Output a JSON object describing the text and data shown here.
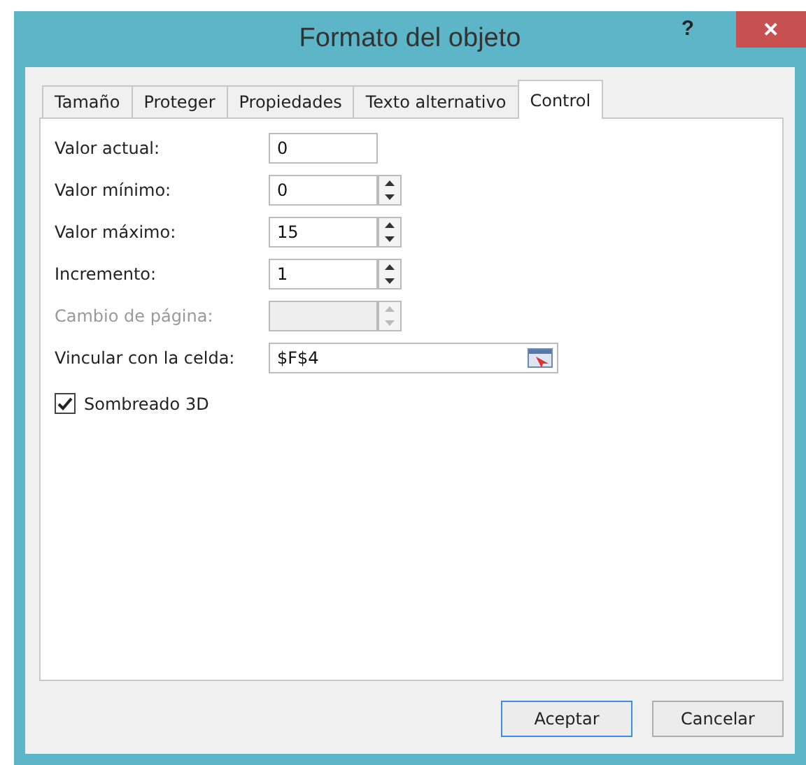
{
  "window": {
    "title": "Formato del objeto",
    "help": "?",
    "close": "✕"
  },
  "tabs": [
    {
      "label": "Tamaño",
      "selected": false
    },
    {
      "label": "Proteger",
      "selected": false
    },
    {
      "label": "Propiedades",
      "selected": false
    },
    {
      "label": "Texto alternativo",
      "selected": false
    },
    {
      "label": "Control",
      "selected": true
    }
  ],
  "fields": [
    {
      "kind": "text",
      "label": "Valor actual:",
      "value": "0",
      "disabled": false
    },
    {
      "kind": "spin",
      "label": "Valor mínimo:",
      "value": "0",
      "disabled": false
    },
    {
      "kind": "spin",
      "label": "Valor máximo:",
      "value": "15",
      "disabled": false
    },
    {
      "kind": "spin",
      "label": "Incremento:",
      "value": "1",
      "disabled": false
    },
    {
      "kind": "spin",
      "label": "Cambio de página:",
      "disabled": true
    },
    {
      "kind": "link",
      "label": "Vincular con la celda:",
      "value": "$F$4",
      "disabled": false
    }
  ],
  "checkbox": {
    "label": "Sombreado 3D",
    "checked": true
  },
  "buttons": [
    {
      "label": "Aceptar",
      "default": true
    },
    {
      "label": "Cancelar",
      "default": false
    }
  ]
}
